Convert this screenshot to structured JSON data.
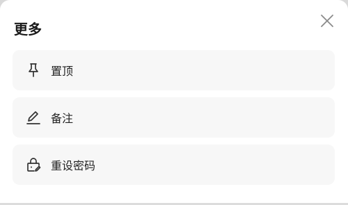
{
  "sheet": {
    "title": "更多",
    "close_icon": "close-icon"
  },
  "items": [
    {
      "label": "置顶",
      "icon": "pin-icon"
    },
    {
      "label": "备注",
      "icon": "edit-pen-icon"
    },
    {
      "label": "重设密码",
      "icon": "lock-edit-icon"
    }
  ],
  "colors": {
    "background": "#ffffff",
    "item_background": "#f7f7f7",
    "text": "#222222",
    "icon": "#333333"
  }
}
